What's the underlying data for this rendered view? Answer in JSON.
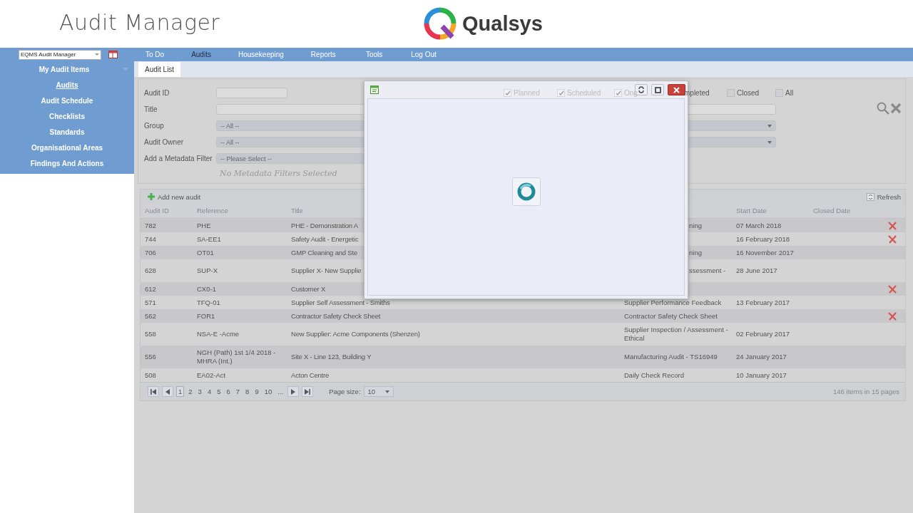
{
  "header": {
    "app_title": "Audit Manager",
    "brand": "Qualsys"
  },
  "nav": [
    {
      "label": "To Do",
      "selected": false
    },
    {
      "label": "Audits",
      "selected": true
    },
    {
      "label": "Housekeeping",
      "selected": false
    },
    {
      "label": "Reports",
      "selected": false
    },
    {
      "label": "Tools",
      "selected": false
    },
    {
      "label": "Log Out",
      "selected": false
    }
  ],
  "sidebar": {
    "module_select": "EQMS Audit Manager",
    "section": "My Audit Items",
    "items": [
      {
        "label": "Audits",
        "selected": true
      },
      {
        "label": "Audit Schedule",
        "selected": false
      },
      {
        "label": "Checklists",
        "selected": false
      },
      {
        "label": "Standards",
        "selected": false
      },
      {
        "label": "Organisational Areas",
        "selected": false
      },
      {
        "label": "Findings And Actions",
        "selected": false
      }
    ]
  },
  "tabs": [
    {
      "label": "Audit List",
      "selected": true
    }
  ],
  "filters": {
    "audit_id_label": "Audit ID",
    "title_label": "Title",
    "group_label": "Group",
    "group_value": "-- All --",
    "owner_label": "Audit Owner",
    "owner_value": "-- All --",
    "metadata_label": "Add a Metadata Filter",
    "metadata_placeholder": "-- Please Select --",
    "metadata_note": "No Metadata Filters Selected",
    "statuses": [
      {
        "kind": "checkbox",
        "label": "Planned",
        "checked": true,
        "disabled": true
      },
      {
        "kind": "checkbox",
        "label": "Scheduled",
        "checked": true,
        "disabled": true
      },
      {
        "kind": "checkbox",
        "label": "Ong",
        "checked": true,
        "disabled": true
      },
      {
        "kind": "text",
        "label": "mpleted"
      },
      {
        "kind": "checkbox",
        "label": "Closed",
        "checked": false,
        "disabled": false
      },
      {
        "kind": "checkbox",
        "label": "All",
        "checked": false,
        "disabled": false
      }
    ]
  },
  "grid": {
    "add_label": "Add new audit",
    "refresh_label": "Refresh",
    "columns": [
      "Audit ID",
      "Reference",
      "Title",
      "",
      "Start Date",
      "Closed Date"
    ],
    "rows": [
      {
        "id": "782",
        "reference": "PHE",
        "title": "PHE - Demonstration A",
        "column_4": "ning",
        "column_4_clipped": true,
        "start_date": "07 March 2018",
        "deletable": true
      },
      {
        "id": "744",
        "reference": "SA-EE1",
        "title": "Safety Audit - Energetic",
        "start_date": "16 February 2018",
        "deletable": true
      },
      {
        "id": "706",
        "reference": "OT01",
        "title": "GMP Cleaning and Ste",
        "column_4": "ning",
        "column_4_clipped": true,
        "start_date": "16 November 2017",
        "deletable": false
      },
      {
        "id": "628",
        "reference": "SUP-X",
        "title": "Supplier X- New Supplie",
        "column_4": "ssessment -",
        "column_4_clipped": true,
        "start_date": "28 June 2017",
        "deletable": false
      },
      {
        "id": "612",
        "reference": "CX0-1",
        "title": "Customer X",
        "deletable": true
      },
      {
        "id": "571",
        "reference": "TFQ-01",
        "title": "Supplier Self Assessment - Smiths",
        "column_4": "Supplier Performance Feedback",
        "column_4_clipped": false,
        "start_date": "13 February 2017",
        "deletable": false
      },
      {
        "id": "562",
        "reference": "FOR1",
        "title": "Contractor Safety Check Sheet",
        "column_4": "Contractor Safety Check Sheet",
        "column_4_clipped": false,
        "deletable": true
      },
      {
        "id": "558",
        "reference": "NSA-E -Acme",
        "title": "New Supplier: Acme Components (Shenzen)",
        "column_4": "Supplier Inspection / Assessment - Ethical",
        "column_4_clipped": false,
        "start_date": "02 February 2017",
        "deletable": false
      },
      {
        "id": "556",
        "reference": "NGH (Path) 1st 1/4 2018 - MHRA (Int.)",
        "title": "Site X - Line 123, Building Y",
        "column_4": "Manufacturing Audit - TS16949",
        "column_4_clipped": false,
        "start_date": "24 January 2017",
        "deletable": false
      },
      {
        "id": "508",
        "reference": "EA02-Act",
        "title": "Acton Centre",
        "column_4": "Daily Check Record",
        "column_4_clipped": false,
        "start_date": "10 January 2017",
        "deletable": false
      }
    ],
    "pager": {
      "pages": [
        {
          "label": "1",
          "selected": true
        },
        {
          "label": "2",
          "selected": false
        },
        {
          "label": "3",
          "selected": false
        },
        {
          "label": "4",
          "selected": false
        },
        {
          "label": "5",
          "selected": false
        },
        {
          "label": "6",
          "selected": false
        },
        {
          "label": "7",
          "selected": false
        },
        {
          "label": "8",
          "selected": false
        },
        {
          "label": "9",
          "selected": false
        },
        {
          "label": "10",
          "selected": false
        },
        {
          "label": "...",
          "selected": false
        }
      ],
      "page_size_label": "Page size:",
      "page_size": "10",
      "summary": "146 items in 15 pages"
    }
  },
  "modal": {
    "loading": true
  }
}
